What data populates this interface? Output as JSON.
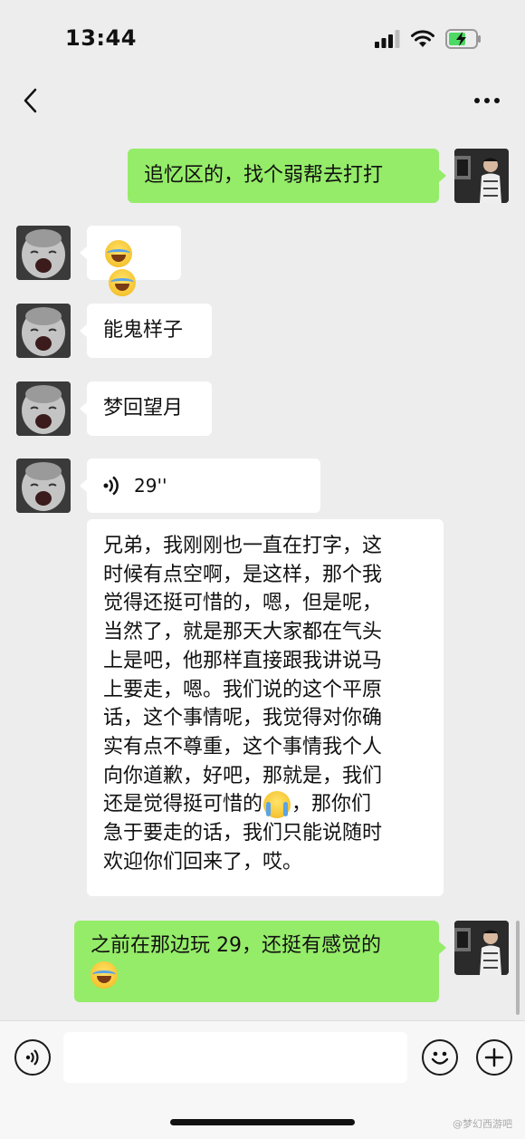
{
  "status_bar": {
    "time": "13:44"
  },
  "nav": {
    "title": "",
    "back_icon": "chevron-left-icon",
    "more_icon": "more-dots-icon"
  },
  "messages": [
    {
      "side": "right",
      "text": "追忆区的，找个弱帮去打打"
    },
    {
      "side": "left",
      "emojis": [
        "laughing-tears-emoji",
        "laughing-tears-emoji"
      ]
    },
    {
      "side": "left",
      "text": "能鬼样子"
    },
    {
      "side": "left",
      "text": "梦回望月"
    },
    {
      "side": "left",
      "voice_duration": "29''"
    },
    {
      "side": "left",
      "lines": [
        "兄弟，我刚刚也一直在打字，这",
        "时候有点空啊，是这样，那个我",
        "觉得还挺可惜的，嗯，但是呢，",
        "当然了，就是那天大家都在气头",
        "上是吧，他那样直接跟我讲说马",
        "上要走，嗯。我们说的这个平原",
        "话，这个事情呢，我觉得对你确",
        "实有点不尊重，这个事情我个人",
        "向你道歉，好吧，那就是，我们",
        "还是觉得挺可惜的",
        "，那你们",
        "急于要走的话，我们只能说随时",
        "欢迎你们回来了，哎。"
      ]
    },
    {
      "side": "right",
      "line1": "之前在那边玩 29，还挺有感觉的"
    }
  ],
  "input_bar": {
    "placeholder": "",
    "voice_icon": "voice-icon",
    "emoji_icon": "emoji-icon",
    "add_icon": "plus-icon"
  },
  "watermark": "@梦幻西游吧",
  "colors": {
    "background": "#ededed",
    "bubble_right": "#95ec69",
    "bubble_left": "#ffffff"
  }
}
